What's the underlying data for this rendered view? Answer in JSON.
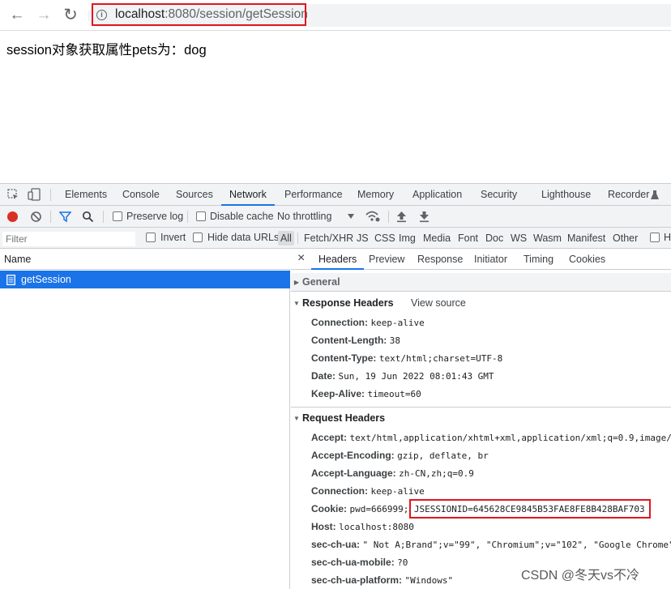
{
  "browser": {
    "back_icon": "←",
    "forward_icon": "→",
    "reload_icon": "↻",
    "url_host": "localhost",
    "url_rest": ":8080/session/getSession"
  },
  "page": {
    "text": "session对象获取属性pets为：dog"
  },
  "devtools": {
    "tabs": [
      "Elements",
      "Console",
      "Sources",
      "Network",
      "Performance",
      "Memory",
      "Application",
      "Security",
      "Lighthouse",
      "Recorder"
    ],
    "active_tab": "Network",
    "toolbar": {
      "preserve_log": "Preserve log",
      "disable_cache": "Disable cache",
      "throttling": "No throttling"
    },
    "filter": {
      "placeholder": "Filter",
      "invert": "Invert",
      "hide_data_urls": "Hide data URLs",
      "types": [
        "All",
        "Fetch/XHR",
        "JS",
        "CSS",
        "Img",
        "Media",
        "Font",
        "Doc",
        "WS",
        "Wasm",
        "Manifest",
        "Other"
      ],
      "trailing_checkbox_label": "H"
    },
    "request_list": {
      "header": "Name",
      "requests": [
        "getSession"
      ]
    },
    "detail_tabs": [
      "Headers",
      "Preview",
      "Response",
      "Initiator",
      "Timing",
      "Cookies"
    ],
    "active_detail_tab": "Headers",
    "close_icon": "×",
    "general": {
      "title": "General"
    },
    "response_headers": {
      "title": "Response Headers",
      "view_source": "View source",
      "rows": [
        {
          "name": "Connection:",
          "value": "keep-alive"
        },
        {
          "name": "Content-Length:",
          "value": "38"
        },
        {
          "name": "Content-Type:",
          "value": "text/html;charset=UTF-8"
        },
        {
          "name": "Date:",
          "value": "Sun, 19 Jun 2022 08:01:43 GMT"
        },
        {
          "name": "Keep-Alive:",
          "value": "timeout=60"
        }
      ]
    },
    "request_headers": {
      "title": "Request Headers",
      "rows": [
        {
          "name": "Accept:",
          "value": "text/html,application/xhtml+xml,application/xml;q=0.9,image/"
        },
        {
          "name": "Accept-Encoding:",
          "value": "gzip, deflate, br"
        },
        {
          "name": "Accept-Language:",
          "value": "zh-CN,zh;q=0.9"
        },
        {
          "name": "Connection:",
          "value": "keep-alive"
        },
        {
          "name": "Cookie:",
          "value": "pwd=666999;",
          "value2": "JSESSIONID=645628CE9845B53FAE8FE8B428BAF703"
        },
        {
          "name": "Host:",
          "value": "localhost:8080"
        },
        {
          "name": "sec-ch-ua:",
          "value": "\" Not A;Brand\";v=\"99\", \"Chromium\";v=\"102\", \"Google Chrome\""
        },
        {
          "name": "sec-ch-ua-mobile:",
          "value": "?0"
        },
        {
          "name": "sec-ch-ua-platform:",
          "value": "\"Windows\""
        }
      ]
    }
  },
  "watermark": "CSDN @冬天vs不冷",
  "colors": {
    "accent": "#1a73e8",
    "highlight_box": "#e3141b",
    "record": "#d93025"
  }
}
